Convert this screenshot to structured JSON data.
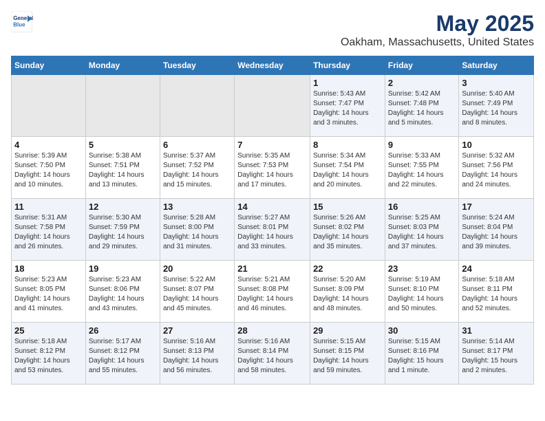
{
  "header": {
    "logo_line1": "General",
    "logo_line2": "Blue",
    "title": "May 2025",
    "subtitle": "Oakham, Massachusetts, United States"
  },
  "weekdays": [
    "Sunday",
    "Monday",
    "Tuesday",
    "Wednesday",
    "Thursday",
    "Friday",
    "Saturday"
  ],
  "weeks": [
    [
      {
        "day": "",
        "info": ""
      },
      {
        "day": "",
        "info": ""
      },
      {
        "day": "",
        "info": ""
      },
      {
        "day": "",
        "info": ""
      },
      {
        "day": "1",
        "info": "Sunrise: 5:43 AM\nSunset: 7:47 PM\nDaylight: 14 hours\nand 3 minutes."
      },
      {
        "day": "2",
        "info": "Sunrise: 5:42 AM\nSunset: 7:48 PM\nDaylight: 14 hours\nand 5 minutes."
      },
      {
        "day": "3",
        "info": "Sunrise: 5:40 AM\nSunset: 7:49 PM\nDaylight: 14 hours\nand 8 minutes."
      }
    ],
    [
      {
        "day": "4",
        "info": "Sunrise: 5:39 AM\nSunset: 7:50 PM\nDaylight: 14 hours\nand 10 minutes."
      },
      {
        "day": "5",
        "info": "Sunrise: 5:38 AM\nSunset: 7:51 PM\nDaylight: 14 hours\nand 13 minutes."
      },
      {
        "day": "6",
        "info": "Sunrise: 5:37 AM\nSunset: 7:52 PM\nDaylight: 14 hours\nand 15 minutes."
      },
      {
        "day": "7",
        "info": "Sunrise: 5:35 AM\nSunset: 7:53 PM\nDaylight: 14 hours\nand 17 minutes."
      },
      {
        "day": "8",
        "info": "Sunrise: 5:34 AM\nSunset: 7:54 PM\nDaylight: 14 hours\nand 20 minutes."
      },
      {
        "day": "9",
        "info": "Sunrise: 5:33 AM\nSunset: 7:55 PM\nDaylight: 14 hours\nand 22 minutes."
      },
      {
        "day": "10",
        "info": "Sunrise: 5:32 AM\nSunset: 7:56 PM\nDaylight: 14 hours\nand 24 minutes."
      }
    ],
    [
      {
        "day": "11",
        "info": "Sunrise: 5:31 AM\nSunset: 7:58 PM\nDaylight: 14 hours\nand 26 minutes."
      },
      {
        "day": "12",
        "info": "Sunrise: 5:30 AM\nSunset: 7:59 PM\nDaylight: 14 hours\nand 29 minutes."
      },
      {
        "day": "13",
        "info": "Sunrise: 5:28 AM\nSunset: 8:00 PM\nDaylight: 14 hours\nand 31 minutes."
      },
      {
        "day": "14",
        "info": "Sunrise: 5:27 AM\nSunset: 8:01 PM\nDaylight: 14 hours\nand 33 minutes."
      },
      {
        "day": "15",
        "info": "Sunrise: 5:26 AM\nSunset: 8:02 PM\nDaylight: 14 hours\nand 35 minutes."
      },
      {
        "day": "16",
        "info": "Sunrise: 5:25 AM\nSunset: 8:03 PM\nDaylight: 14 hours\nand 37 minutes."
      },
      {
        "day": "17",
        "info": "Sunrise: 5:24 AM\nSunset: 8:04 PM\nDaylight: 14 hours\nand 39 minutes."
      }
    ],
    [
      {
        "day": "18",
        "info": "Sunrise: 5:23 AM\nSunset: 8:05 PM\nDaylight: 14 hours\nand 41 minutes."
      },
      {
        "day": "19",
        "info": "Sunrise: 5:23 AM\nSunset: 8:06 PM\nDaylight: 14 hours\nand 43 minutes."
      },
      {
        "day": "20",
        "info": "Sunrise: 5:22 AM\nSunset: 8:07 PM\nDaylight: 14 hours\nand 45 minutes."
      },
      {
        "day": "21",
        "info": "Sunrise: 5:21 AM\nSunset: 8:08 PM\nDaylight: 14 hours\nand 46 minutes."
      },
      {
        "day": "22",
        "info": "Sunrise: 5:20 AM\nSunset: 8:09 PM\nDaylight: 14 hours\nand 48 minutes."
      },
      {
        "day": "23",
        "info": "Sunrise: 5:19 AM\nSunset: 8:10 PM\nDaylight: 14 hours\nand 50 minutes."
      },
      {
        "day": "24",
        "info": "Sunrise: 5:18 AM\nSunset: 8:11 PM\nDaylight: 14 hours\nand 52 minutes."
      }
    ],
    [
      {
        "day": "25",
        "info": "Sunrise: 5:18 AM\nSunset: 8:12 PM\nDaylight: 14 hours\nand 53 minutes."
      },
      {
        "day": "26",
        "info": "Sunrise: 5:17 AM\nSunset: 8:12 PM\nDaylight: 14 hours\nand 55 minutes."
      },
      {
        "day": "27",
        "info": "Sunrise: 5:16 AM\nSunset: 8:13 PM\nDaylight: 14 hours\nand 56 minutes."
      },
      {
        "day": "28",
        "info": "Sunrise: 5:16 AM\nSunset: 8:14 PM\nDaylight: 14 hours\nand 58 minutes."
      },
      {
        "day": "29",
        "info": "Sunrise: 5:15 AM\nSunset: 8:15 PM\nDaylight: 14 hours\nand 59 minutes."
      },
      {
        "day": "30",
        "info": "Sunrise: 5:15 AM\nSunset: 8:16 PM\nDaylight: 15 hours\nand 1 minute."
      },
      {
        "day": "31",
        "info": "Sunrise: 5:14 AM\nSunset: 8:17 PM\nDaylight: 15 hours\nand 2 minutes."
      }
    ]
  ]
}
